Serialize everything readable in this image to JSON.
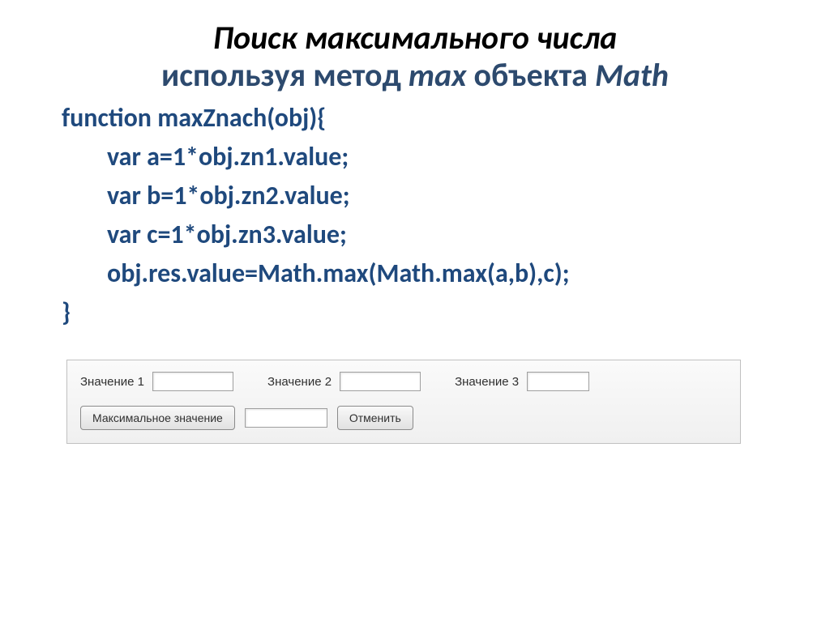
{
  "title": "Поиск максимального числа",
  "subtitle_plain1": "используя метод ",
  "subtitle_italic1": "max",
  "subtitle_plain2": " объекта ",
  "subtitle_italic2": "Math",
  "code": {
    "line1": "function maxZnach(obj){",
    "line2": "var a=1*obj.zn1.value;",
    "line3": "var b=1*obj.zn2.value;",
    "line4": "var c=1*obj.zn3.value;",
    "line5": "obj.res.value=Math.max(Math.max(a,b),c);",
    "line6": "}"
  },
  "form": {
    "label1": "Значение 1",
    "label2": "Значение 2",
    "label3": "Значение 3",
    "value1": "",
    "value2": "",
    "value3": "",
    "maxButton": "Максимальное значение",
    "result": "",
    "cancelButton": "Отменить"
  }
}
